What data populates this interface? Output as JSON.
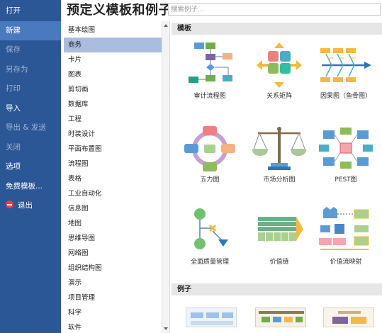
{
  "app": {
    "title": "预定义模板和例子"
  },
  "search": {
    "placeholder": "搜索例子..."
  },
  "nav": {
    "items": [
      {
        "label": "打开",
        "style": "normal"
      },
      {
        "label": "新建",
        "style": "active"
      },
      {
        "label": "保存",
        "style": "dim"
      },
      {
        "label": "另存为",
        "style": "dim"
      },
      {
        "label": "打印",
        "style": "dim"
      },
      {
        "label": "导入",
        "style": "normal"
      },
      {
        "label": "导出 & 发送",
        "style": "dim"
      },
      {
        "label": "关闭",
        "style": "dim"
      },
      {
        "label": "选项",
        "style": "normal"
      },
      {
        "label": "免费模板...",
        "style": "normal"
      },
      {
        "label": "退出",
        "style": "normal",
        "icon": "exit-icon"
      }
    ]
  },
  "categories": [
    "基本绘图",
    "商务",
    "卡片",
    "图表",
    "剪切画",
    "数据库",
    "工程",
    "时装设计",
    "平面布置图",
    "流程图",
    "表格",
    "工业自动化",
    "信息图",
    "地图",
    "思维导图",
    "网络图",
    "组织结构图",
    "演示",
    "项目管理",
    "科学",
    "软件"
  ],
  "selected_category": "商务",
  "sections": {
    "templates_label": "模板",
    "examples_label": "例子"
  },
  "templates": [
    {
      "label": "审计流程图",
      "icon": "audit-flowchart-icon"
    },
    {
      "label": "关系矩阵",
      "icon": "relation-matrix-icon"
    },
    {
      "label": "因果图（鱼骨图）",
      "icon": "fishbone-icon"
    },
    {
      "label": "五力图",
      "icon": "five-forces-icon"
    },
    {
      "label": "市场分析图",
      "icon": "balance-scale-icon"
    },
    {
      "label": "PEST图",
      "icon": "pest-icon"
    },
    {
      "label": "全面质量管理",
      "icon": "tqm-icon"
    },
    {
      "label": "价值链",
      "icon": "value-chain-icon"
    },
    {
      "label": "价值流映射",
      "icon": "value-stream-icon"
    }
  ],
  "colors": {
    "nav_bg": "#2b5797",
    "nav_active": "#4a79c0",
    "selected_category": "#aabce0",
    "section_header": "#e6e6e6"
  }
}
